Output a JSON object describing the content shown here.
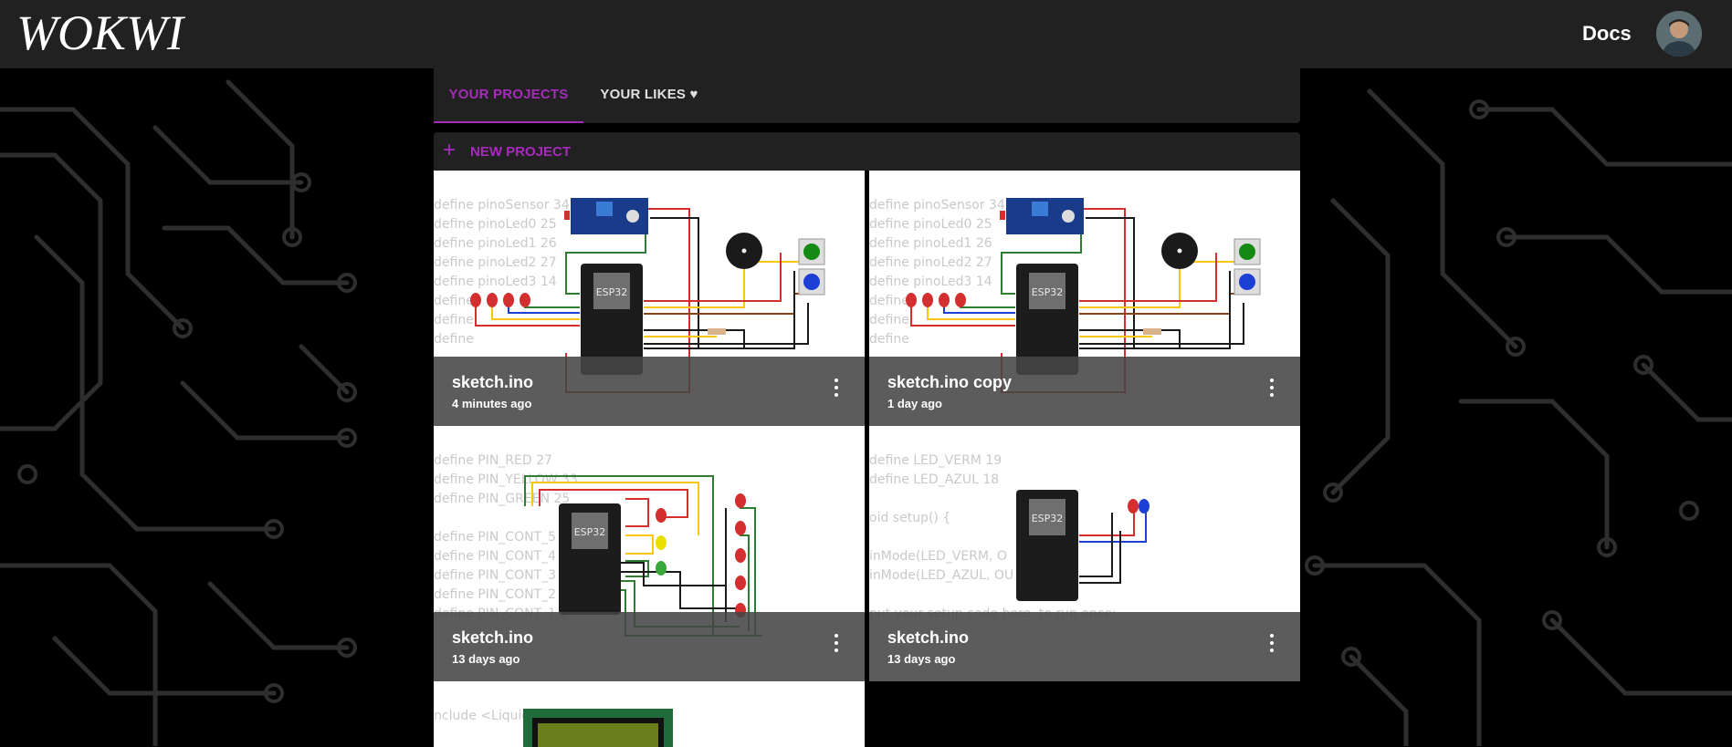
{
  "header": {
    "logo_text": "WOKWI",
    "docs_label": "Docs"
  },
  "tabs": [
    {
      "label": "YOUR PROJECTS",
      "active": true
    },
    {
      "label": "YOUR LIKES ♥",
      "active": false
    }
  ],
  "new_project": {
    "label": "NEW PROJECT"
  },
  "projects": [
    {
      "title": "sketch.ino",
      "date": "4 minutes ago",
      "code": [
        "define pinoSensor 34",
        "define pinoLed0 25",
        "define pinoLed1 26",
        "define pinoLed2 27",
        "define pinoLed3 14",
        "define",
        "define",
        "define"
      ]
    },
    {
      "title": "sketch.ino copy",
      "date": "1 day ago",
      "code": [
        "define pinoSensor 34",
        "define pinoLed0 25",
        "define pinoLed1 26",
        "define pinoLed2 27",
        "define pinoLed3 14",
        "define",
        "define",
        "define"
      ]
    },
    {
      "title": "sketch.ino",
      "date": "13 days ago",
      "code": [
        "define PIN_RED 27",
        "define PIN_YELLOW 33",
        "define PIN_GREEN 25",
        "",
        "define PIN_CONT_5 2",
        "define PIN_CONT_4",
        "define PIN_CONT_3 1",
        "define PIN_CONT_2 4",
        "define PIN_CONT_1 2"
      ]
    },
    {
      "title": "sketch.ino",
      "date": "13 days ago",
      "code": [
        "define LED_VERM 19",
        "define LED_AZUL 18",
        "",
        "oid setup() {",
        "",
        "inMode(LED_VERM,  O",
        "inMode(LED_AZUL, OU",
        "",
        "  put your setup code here, to run once:"
      ]
    },
    {
      "title": "",
      "date": "",
      "code": [
        "nclude <Liquid"
      ]
    }
  ],
  "chip_label": "ESP32",
  "colors": {
    "accent": "#a62bbc",
    "topbar": "#212121",
    "wire_red": "#d32f2f",
    "wire_green": "#2e7d32",
    "wire_yellow": "#f9c80e",
    "wire_blue": "#1e3fd6"
  }
}
